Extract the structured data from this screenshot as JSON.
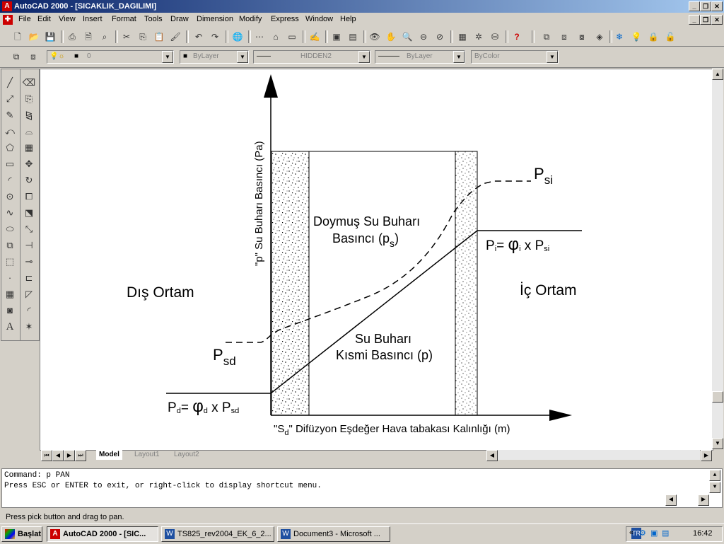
{
  "window": {
    "title": "AutoCAD 2000 - [SICAKLIK_DAGILIMI]",
    "app_icon": "autocad-icon"
  },
  "menu": [
    "File",
    "Edit",
    "View",
    "Insert",
    "Format",
    "Tools",
    "Draw",
    "Dimension",
    "Modify",
    "Express",
    "Window",
    "Help"
  ],
  "properties": {
    "layer": "0",
    "color": "ByLayer",
    "linetype_left": "——",
    "linetype": "HIDDEN2",
    "lineweight": "ByLayer",
    "plotstyle": "ByColor"
  },
  "drawing": {
    "y_axis_label": "\"p\" Su Buharı Basıncı (Pa)",
    "x_axis_label_pre": "\"S",
    "x_axis_label_sub": "d",
    "x_axis_label_post": "\" Difüzyon Eşdeğer Hava tabakası Kalınlığı (m)",
    "outside_label": "Dış Ortam",
    "inside_label": "İç Ortam",
    "sat_line1": "Doymuş Su Buharı",
    "sat_line2_pre": "Basıncı (p",
    "sat_line2_sub": "s",
    "sat_line2_post": ")",
    "partial_line1": "Su Buharı",
    "partial_line2": "Kısmi Basıncı (p)",
    "psi_main": "P",
    "psi_sub": "si",
    "psd_main": "P",
    "psd_sub": "sd",
    "pi_p": "P",
    "pi_sub": "i",
    "pi_eq": "= ",
    "pi_phi": "φ",
    "pi_phisub": "i",
    "pi_x": " x P",
    "pi_sisub": "si",
    "pd_p": "P",
    "pd_sub": "d",
    "pd_eq": "= ",
    "pd_phi": "φ",
    "pd_phisub": "d",
    "pd_x": " x P",
    "pd_sdsub": "sd"
  },
  "tabs": {
    "model": "Model",
    "layout1": "Layout1",
    "layout2": "Layout2"
  },
  "command": {
    "line1": "Command: p PAN",
    "line2": "Press ESC or ENTER to exit, or right-click to display shortcut menu."
  },
  "status_text": "Press pick button and drag to pan.",
  "taskbar": {
    "start": "Başlat",
    "items": [
      "AutoCAD 2000 - [SIC...",
      "TS825_rev2004_EK_6_2...",
      "Document3 - Microsoft ..."
    ],
    "lang": "TR",
    "clock": "16:42"
  }
}
